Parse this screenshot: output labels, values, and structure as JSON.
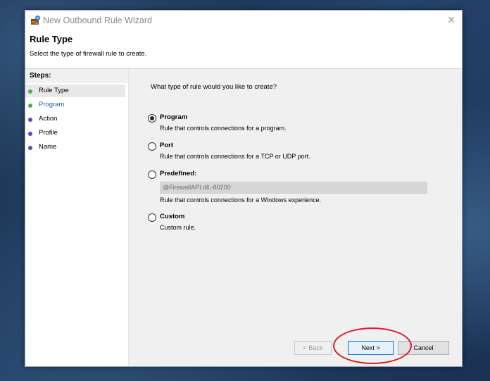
{
  "window": {
    "title": "New Outbound Rule Wizard",
    "close_symbol": "✕",
    "icon": "firewall-wizard-icon"
  },
  "header": {
    "title": "Rule Type",
    "subtitle": "Select the type of firewall rule to create."
  },
  "steps": {
    "title": "Steps:",
    "items": [
      {
        "label": "Rule Type",
        "state": "current",
        "dot_color": "#4caf50"
      },
      {
        "label": "Program",
        "state": "link",
        "dot_color": "#4caf50"
      },
      {
        "label": "Action",
        "state": "pending",
        "dot_color": "#5b4db5"
      },
      {
        "label": "Profile",
        "state": "pending",
        "dot_color": "#5b4db5"
      },
      {
        "label": "Name",
        "state": "pending",
        "dot_color": "#5b4db5"
      }
    ]
  },
  "main": {
    "question": "What type of rule would you like to create?",
    "options": [
      {
        "title": "Program",
        "description": "Rule that controls connections for a program.",
        "selected": true
      },
      {
        "title": "Port",
        "description": "Rule that controls connections for a TCP or UDP port.",
        "selected": false
      },
      {
        "title": "Predefined:",
        "select_value": "@FirewallAPI.dll,-80200",
        "description": "Rule that controls connections for a Windows experience.",
        "selected": false
      },
      {
        "title": "Custom",
        "description": "Custom rule.",
        "selected": false
      }
    ]
  },
  "buttons": {
    "back": "< Back",
    "next": "Next >",
    "cancel": "Cancel"
  },
  "annotation": {
    "color": "#d4202a"
  }
}
